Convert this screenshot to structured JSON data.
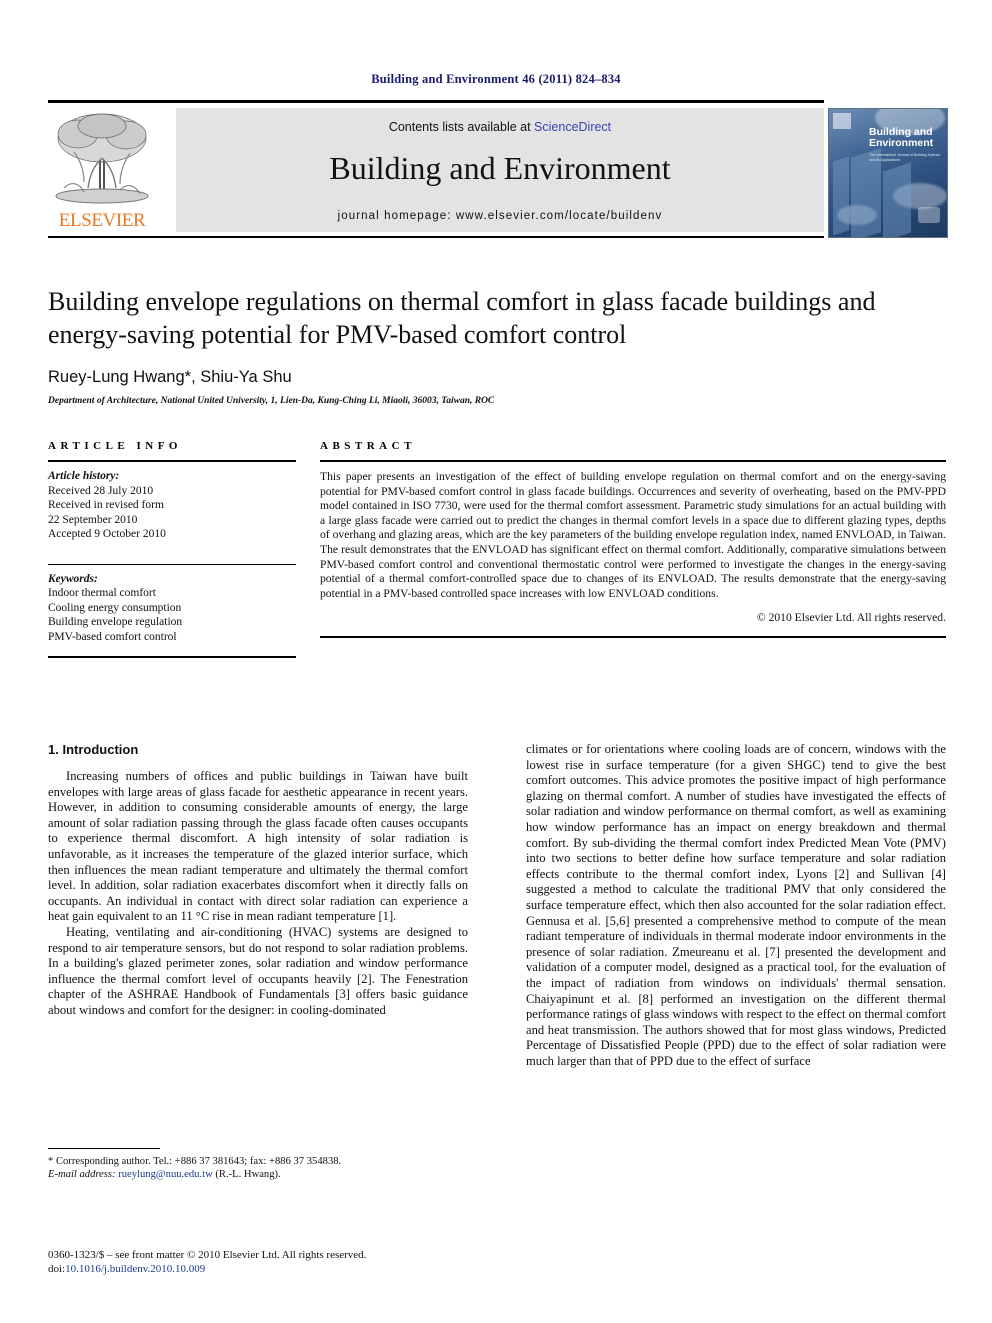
{
  "running_head": "Building and Environment 46 (2011) 824–834",
  "masthead": {
    "contents_prefix": "Contents lists available at ",
    "sciencedirect": "ScienceDirect",
    "journal_title": "Building and Environment",
    "homepage": "journal homepage: www.elsevier.com/locate/buildenv",
    "publisher_wordmark": "ELSEVIER",
    "cover": {
      "title_line1": "Building and",
      "title_line2": "Environment",
      "subtitle": "The International Journal of Building Science and its Applications"
    },
    "link_color": "#3a43b0",
    "wordmark_color": "#e87722"
  },
  "article": {
    "title": "Building envelope regulations on thermal comfort in glass facade buildings and energy-saving potential for PMV-based comfort control",
    "authors": "Ruey-Lung Hwang*, Shiu-Ya Shu",
    "affiliation": "Department of Architecture, National United University, 1, Lien-Da, Kung-Ching Li, Miaoli, 36003, Taiwan, ROC"
  },
  "article_info": {
    "heading": "ARTICLE INFO",
    "history_label": "Article history:",
    "history": [
      "Received 28 July 2010",
      "Received in revised form",
      "22 September 2010",
      "Accepted 9 October 2010"
    ],
    "keywords_label": "Keywords:",
    "keywords": [
      "Indoor thermal comfort",
      "Cooling energy consumption",
      "Building envelope regulation",
      "PMV-based comfort control"
    ]
  },
  "abstract": {
    "heading": "ABSTRACT",
    "text": "This paper presents an investigation of the effect of building envelope regulation on thermal comfort and on the energy-saving potential for PMV-based comfort control in glass facade buildings. Occurrences and severity of overheating, based on the PMV-PPD model contained in ISO 7730, were used for the thermal comfort assessment. Parametric study simulations for an actual building with a large glass facade were carried out to predict the changes in thermal comfort levels in a space due to different glazing types, depths of overhang and glazing areas, which are the key parameters of the building envelope regulation index, named ENVLOAD, in Taiwan. The result demonstrates that the ENVLOAD has significant effect on thermal comfort. Additionally, comparative simulations between PMV-based comfort control and conventional thermostatic control were performed to investigate the changes in the energy-saving potential of a thermal comfort-controlled space due to changes of its ENVLOAD. The results demonstrate that the energy-saving potential in a PMV-based controlled space increases with low ENVLOAD conditions.",
    "copyright": "© 2010 Elsevier Ltd. All rights reserved."
  },
  "body": {
    "section_number_title": "1. Introduction",
    "left_paragraphs": [
      "Increasing numbers of offices and public buildings in Taiwan have built envelopes with large areas of glass facade for aesthetic appearance in recent years. However, in addition to consuming considerable amounts of energy, the large amount of solar radiation passing through the glass facade often causes occupants to experience thermal discomfort. A high intensity of solar radiation is unfavorable, as it increases the temperature of the glazed interior surface, which then influences the mean radiant temperature and ultimately the thermal comfort level. In addition, solar radiation exacerbates discomfort when it directly falls on occupants. An individual in contact with direct solar radiation can experience a heat gain equivalent to an 11 °C rise in mean radiant temperature [1].",
      "Heating, ventilating and air-conditioning (HVAC) systems are designed to respond to air temperature sensors, but do not respond to solar radiation problems. In a building's glazed perimeter zones, solar radiation and window performance influence the thermal comfort level of occupants heavily [2]. The Fenestration chapter of the ASHRAE Handbook of Fundamentals [3] offers basic guidance about windows and comfort for the designer: in cooling-dominated"
    ],
    "right_paragraphs": [
      "climates or for orientations where cooling loads are of concern, windows with the lowest rise in surface temperature (for a given SHGC) tend to give the best comfort outcomes. This advice promotes the positive impact of high performance glazing on thermal comfort. A number of studies have investigated the effects of solar radiation and window performance on thermal comfort, as well as examining how window performance has an impact on energy breakdown and thermal comfort. By sub-dividing the thermal comfort index Predicted Mean Vote (PMV) into two sections to better define how surface temperature and solar radiation effects contribute to the thermal comfort index, Lyons [2] and Sullivan [4] suggested a method to calculate the traditional PMV that only considered the surface temperature effect, which then also accounted for the solar radiation effect. Gennusa et al. [5,6] presented a comprehensive method to compute of the mean radiant temperature of individuals in thermal moderate indoor environments in the presence of solar radiation. Zmeureanu et al. [7] presented the development and validation of a computer model, designed as a practical tool, for the evaluation of the impact of radiation from windows on individuals' thermal sensation. Chaiyapinunt et al. [8] performed an investigation on the different thermal performance ratings of glass windows with respect to the effect on thermal comfort and heat transmission. The authors showed that for most glass windows, Predicted Percentage of Dissatisfied People (PPD) due to the effect of solar radiation were much larger than that of PPD due to the effect of surface"
    ]
  },
  "footer": {
    "corresponding_note": "* Corresponding author. Tel.: +886 37 381643; fax: +886 37 354838.",
    "email_label": "E-mail address:",
    "email": "rueylung@nuu.edu.tw",
    "email_owner": "(R.-L. Hwang).",
    "issn_line": "0360-1323/$ – see front matter © 2010 Elsevier Ltd. All rights reserved.",
    "doi_prefix": "doi:",
    "doi": "10.1016/j.buildenv.2010.10.009"
  }
}
